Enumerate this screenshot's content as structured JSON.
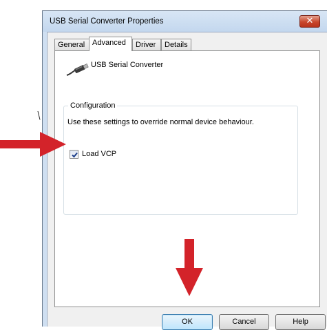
{
  "stray_text": "\\",
  "window": {
    "title": "USB Serial Converter Properties",
    "close_glyph": "✕"
  },
  "tabs": [
    {
      "label": "General"
    },
    {
      "label": "Advanced"
    },
    {
      "label": "Driver"
    },
    {
      "label": "Details"
    }
  ],
  "device": {
    "name": "USB Serial Converter",
    "icon": "usb-cable-icon"
  },
  "configuration": {
    "legend": "Configuration",
    "description": "Use these settings to override normal device behaviour.",
    "load_vcp": {
      "label": "Load VCP",
      "checked": true
    }
  },
  "buttons": {
    "ok": "OK",
    "cancel": "Cancel",
    "help": "Help"
  },
  "annotations": {
    "arrow_color": "#d3232a",
    "arrow_icon": "red-arrow-icon"
  }
}
